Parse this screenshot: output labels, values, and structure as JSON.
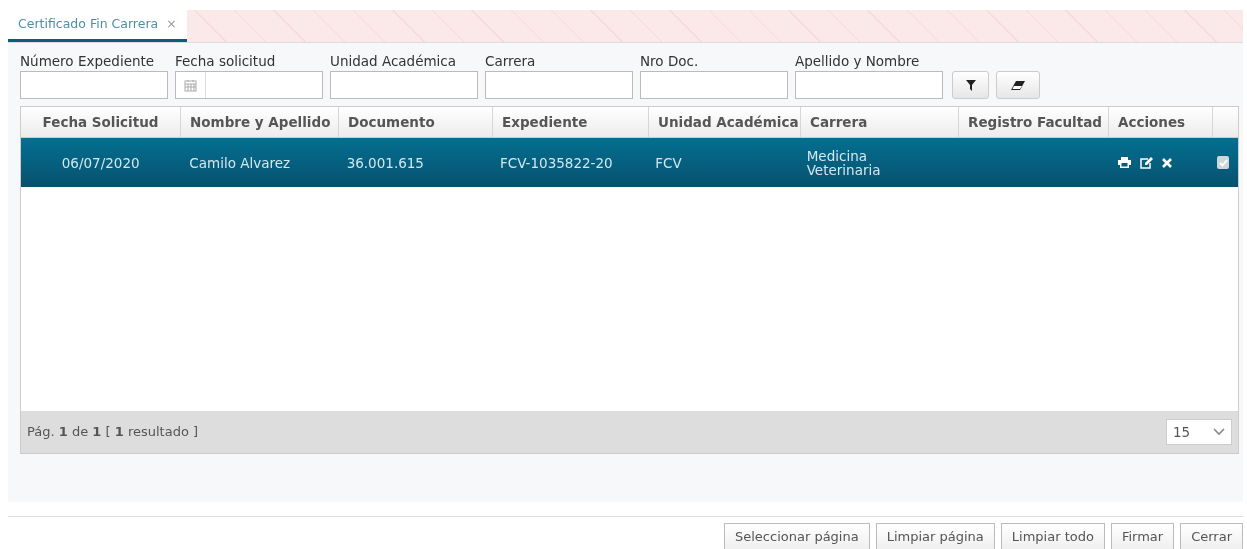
{
  "tabs": [
    {
      "label": "Certificado Fin Carrera",
      "close": "×",
      "selected": true
    }
  ],
  "filters": [
    {
      "label": "Número Expediente",
      "kind": "text"
    },
    {
      "label": "Fecha solicitud",
      "kind": "date"
    },
    {
      "label": "Unidad Académica",
      "kind": "text"
    },
    {
      "label": "Carrera",
      "kind": "text"
    },
    {
      "label": "Nro Doc.",
      "kind": "text"
    },
    {
      "label": "Apellido y Nombre",
      "kind": "text"
    }
  ],
  "table": {
    "columns": [
      "Fecha Solicitud",
      "Nombre y Apellido",
      "Documento",
      "Expediente",
      "Unidad Académica",
      "Carrera",
      "Registro Facultad",
      "Acciones"
    ],
    "rows": [
      {
        "cells": [
          "06/07/2020",
          "Camilo Alvarez",
          "36.001.615",
          "FCV-1035822-20",
          "FCV",
          "Medicina\nVeterinaria",
          ""
        ],
        "selected": true,
        "checked": true
      }
    ]
  },
  "pager": {
    "info": "Pág. **1** de **1** [ **1** resultado ]",
    "page_size": "15"
  },
  "buttons": [
    "Seleccionar página",
    "Limpiar página",
    "Limpiar todo",
    "Firmar",
    "Cerrar"
  ]
}
